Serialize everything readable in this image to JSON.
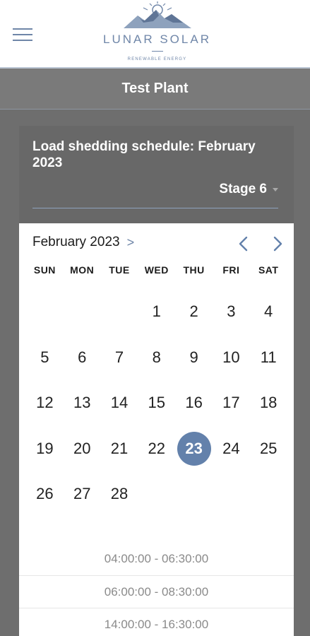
{
  "header": {
    "menu_icon": "hamburger-menu-icon",
    "logo": {
      "name": "LUNAR SOLAR",
      "tagline": "RENEWABLE ENERGY",
      "mark_icon": "mountain-sun-icon",
      "color": "#6f86a8"
    }
  },
  "titlebar": {
    "title": "Test Plant"
  },
  "schedule": {
    "title": "Load shedding schedule: February 2023",
    "stage": "Stage 6"
  },
  "calendar": {
    "month_label": "February 2023",
    "month_chevron": ">",
    "prev_icon": "chevron-left-icon",
    "next_icon": "chevron-right-icon",
    "weekdays": [
      "SUN",
      "MON",
      "TUE",
      "WED",
      "THU",
      "FRI",
      "SAT"
    ],
    "leading_blanks": 3,
    "days": [
      "1",
      "2",
      "3",
      "4",
      "5",
      "6",
      "7",
      "8",
      "9",
      "10",
      "11",
      "12",
      "13",
      "14",
      "15",
      "16",
      "17",
      "18",
      "19",
      "20",
      "21",
      "22",
      "23",
      "24",
      "25",
      "26",
      "27",
      "28"
    ],
    "selected_day": "23",
    "accent_color": "#6381ab"
  },
  "time_slots": [
    "04:00:00 - 06:30:00",
    "06:00:00 - 08:30:00",
    "14:00:00 - 16:30:00"
  ]
}
